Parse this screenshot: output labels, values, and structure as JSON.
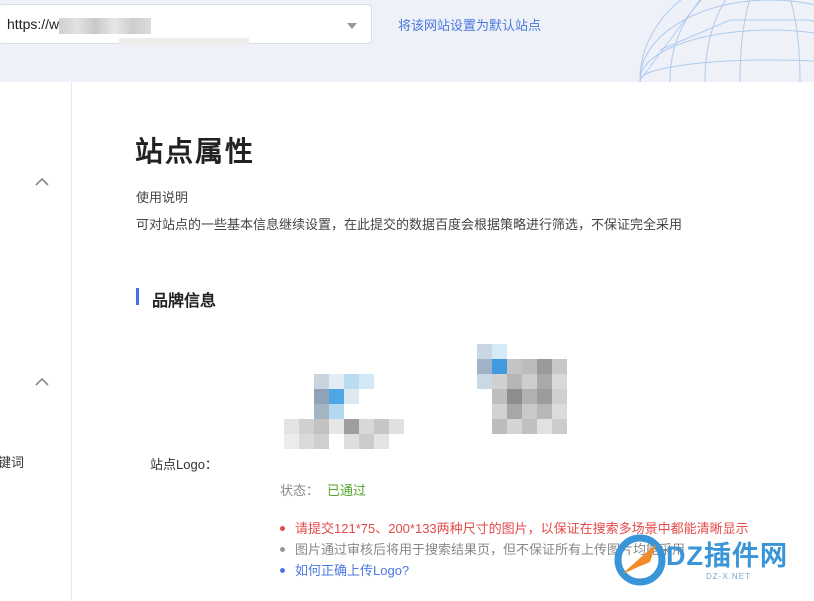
{
  "topbar": {
    "site_url": "https://w",
    "set_default_link": "将该网站设置为默认站点"
  },
  "sidebar": {
    "partial_text": "键词"
  },
  "page": {
    "title": "站点属性",
    "usage_label": "使用说明",
    "usage_text": "可对站点的一些基本信息继续设置，在此提交的数据百度会根据策略进行筛选，不保证完全采用",
    "section_title": "品牌信息"
  },
  "logo": {
    "label": "站点Logo：",
    "status_label": "状态：",
    "status_value": "已通过",
    "notes": [
      "请提交121*75、200*133两种尺寸的图片，以保证在搜索多场景中都能清晰显示",
      "图片通过审核后将用于搜索结果页，但不保证所有上传图片均能采用",
      "如何正确上传Logo?"
    ]
  },
  "watermark": {
    "text": "DZ插件网",
    "sub": "DZ-X.NET"
  },
  "colors": {
    "accent": "#3e72e8",
    "link": "#4a78e0",
    "success": "#52a629",
    "warning": "#e54a4a",
    "topbar_bg": "#eef1f8"
  },
  "icons": {
    "dropdown": "caret-down-icon",
    "collapse": "chevron-up-icon"
  }
}
